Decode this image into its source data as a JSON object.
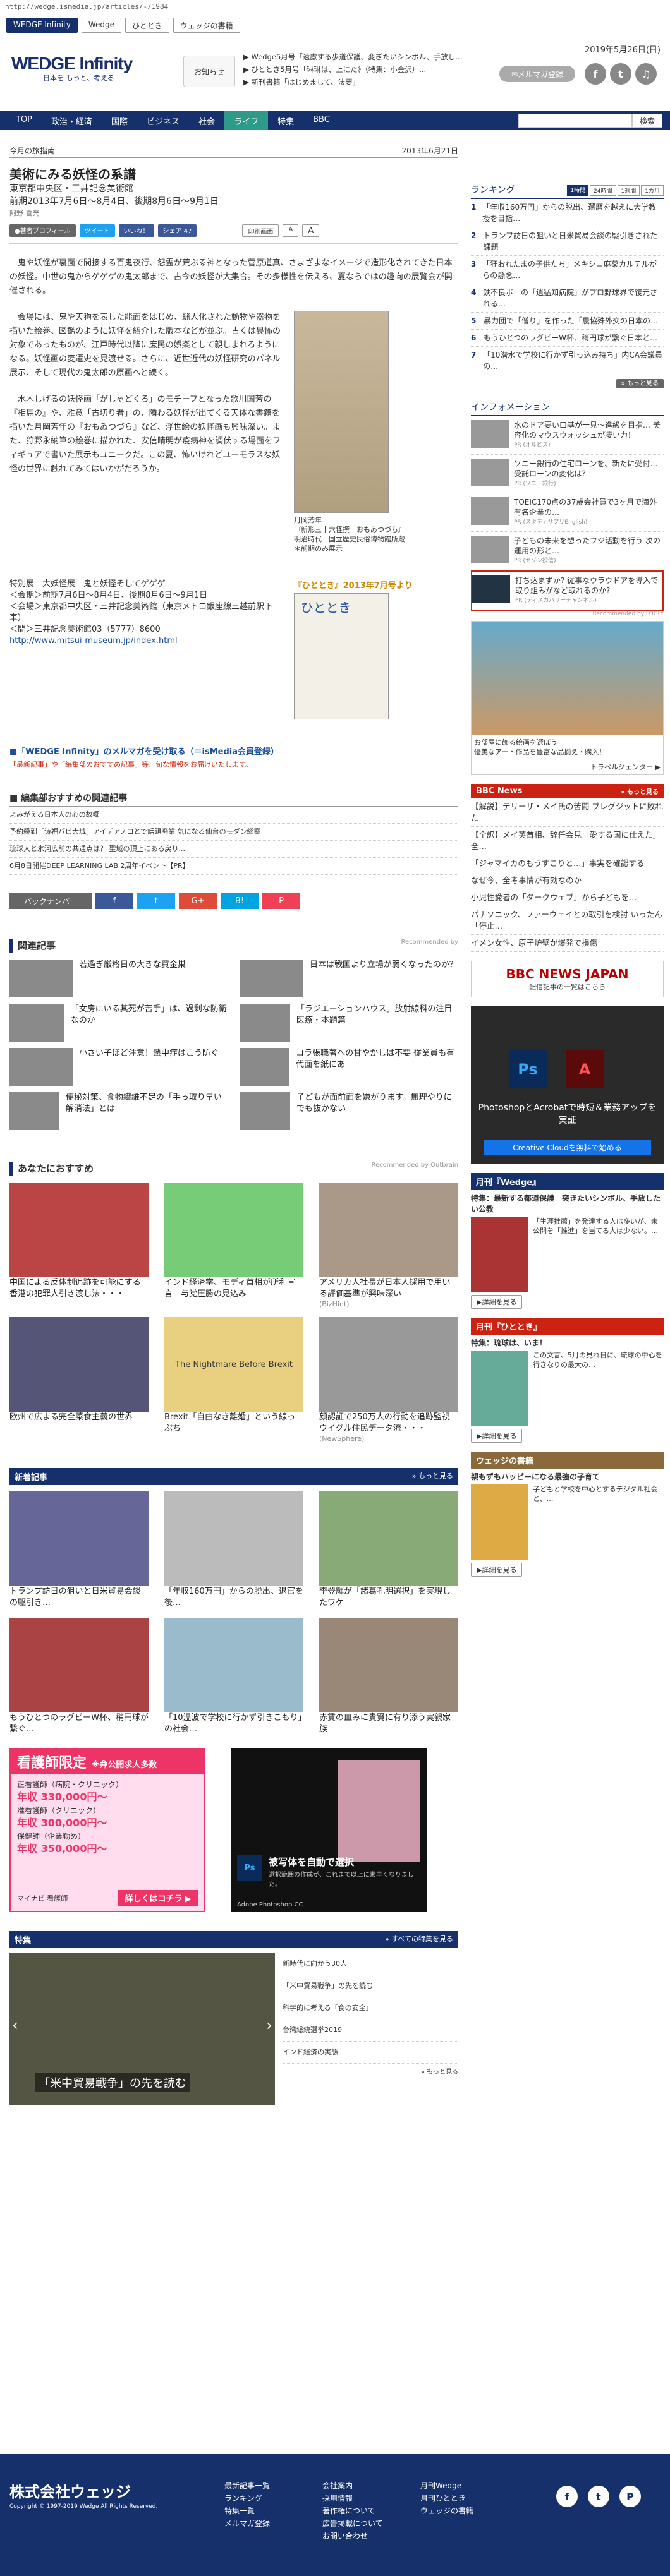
{
  "url": "http://wedge.ismedia.jp/articles/-/1984",
  "site_tabs": [
    "WEDGE Infinity",
    "Wedge",
    "ひととき",
    "ウェッジの書籍"
  ],
  "date": "2019年5月26日(日)",
  "logo": {
    "main": "WEDGE Infinity",
    "sub": "日本を もっと、考える"
  },
  "oshirase": "お知らせ",
  "news": [
    "▶ Wedge5月号「遠慮する歩道保護、変ぎたいシンボル、手放し…",
    "▶ ひととき5月号「琳琳は、上にた》（特集：小金沢）...",
    "▶ 新刊書籍「はじめまして、法要」"
  ],
  "mail_btn": "✉メルマガ登録",
  "sns": [
    "f",
    "t",
    "♫"
  ],
  "nav": [
    "TOP",
    "政治・経済",
    "国際",
    "ビジネス",
    "社会",
    "ライフ",
    "特集",
    "BBC"
  ],
  "search_btn": "検索",
  "article": {
    "section": "今月の旅指南",
    "date": "2013年6月21日",
    "title": "美術にみる妖怪の系譜",
    "sub1": "東京都中央区・三井記念美術館",
    "sub2": "前期2013年7月6日〜8月4日、後期8月6日〜9月1日",
    "author": "阿野 喜光",
    "buttons": [
      "●著者プロフィール",
      "ツイート",
      "いいね！",
      "シェア 47",
      "印刷画面",
      "A",
      "A"
    ],
    "p1": "鬼や妖怪が裏面で間接する百鬼夜行、怨霊が荒ぶる神となった菅原道真、さまざまなイメージで造形化されてきた日本の妖怪。中世の鬼からゲゲゲの鬼太郎まで、古今の妖怪が大集合。その多様性を伝える、夏ならではの趣向の展覧会が開催される。",
    "p2": "会場には、鬼や天狗を表した能面をはじめ、蝋人化された動物や器物を描いた絵巻、図鑑のように妖怪を紹介した版本などが並ぶ。古くは畏怖の対象であったものが、江戸時代以降に庶民の娯楽として親しまれるようになる。妖怪画の変遷史を見渡せる。さらに、近世近代の妖怪研究のパネル展示、そして現代の鬼太郎の原画へと続く。",
    "p3": "水木しげるの妖怪画「がしゃどくろ」のモチーフとなった歌川国芳の『相馬の』や、雅意「古切り者」の、隣わる妖怪が出てくる天体な書籍を描いた月岡芳年の『おもゐつづら』など、浮世絵の妖怪画も興味深い。また、狩野永納筆の絵巻に描かれた、安信晴明が疫病神を調伏する場面をフィギュアで書いた展示もユニークだ。この夏、怖いけれどユーモラスな妖怪の世界に触れてみてはいかがだろうか。",
    "img_caption": "月岡芳年\n『新形三十六怪撰　おもゐつづら』\n明治時代　国立歴史民俗博物館所蔵\n＊前期のみ展示",
    "info_title": "特別展　大妖怪展—鬼と妖怪そしてゲゲゲ—",
    "info_period": "＜会期＞前期7月6日〜8月4日、後期8月6日〜9月1日",
    "info_place": "＜会場＞東京都中央区・三井記念美術館（東京メトロ銀座線三越前駅下車）",
    "info_tel": "＜問＞三井記念美術館03（5777）8600",
    "info_url": "http://www.mitsui-museum.jp/index.html",
    "hitotoki_link": "『ひととき』2013年7月号より",
    "hitotoki_logo": "ひととき",
    "mag_link": "■「WEDGE Infinity」のメルマガを受け取る（＝isMedia会員登録）",
    "mag_note": "「最新記事」や「編集部のおすすめ記事」等、旬な情報をお届けいたします。",
    "rec_title": "■ 編集部おすすめの関連記事",
    "rec": [
      "よみがえる日本人の心の故郷",
      "予約殺到「诗福パビ大城」アイデアノロとで話題廃業 気になる仙台のモダン総案",
      "琉球人と氷河広前の共通点は？ 聖域の頂上にある戻り...",
      "6月8日開催DEEP LEARNING LAB 2周年イベント【PR】"
    ],
    "backnumber": "バックナンバー",
    "share": [
      "f",
      "t",
      "G+",
      "B!",
      "P"
    ]
  },
  "related": {
    "title": "関連記事",
    "recby": "Recommended by",
    "items": [
      "若過ぎ厳格日の大きな買金巣",
      "日本は戦国より立場が弱くなったのか？",
      "「女房にいる其死が苦手」は、過剰な防衛なのか",
      "「ラジエーションハウス」放射線科の注目医療・本題篇",
      "小さい子ほど注意！熱中症はこう防ぐ",
      "コラ張職著への甘やかしは不要 従業員も有代面を紙にあ",
      "便秘対策、食物繊維不足の「手っ取り早い解消法」とは",
      "子どもが面前面を嫌がります。無理やりにでも抜かない"
    ]
  },
  "osusume": {
    "title": "あなたにおすすめ",
    "recby": "Recommended by Outbrain",
    "items": [
      "中国による反体制追跡を可能にする香港の犯罪人引き渡し法・・・",
      "インド経済学、モディ首相が所利宣言　与党圧勝の見込み",
      "アメリカ人社長が日本人採用で用いる評価基準が興味深い",
      "欧州で広まる完全菜食主義の世界",
      "Brexit「自由なき離婚」という線っぷち",
      "顔認証で250万人の行動を追跡監視　ウイグル住民データ流・・・"
    ],
    "sponsor": [
      "(BizHint)",
      "(NewSphere)"
    ],
    "img_text": "The Nightmare Before Brexit"
  },
  "newest": {
    "title": "新着記事",
    "more": "» もっと見る",
    "items": [
      "トランプ訪日の狙いと日米貿易会談の駆引き…",
      "「年収160万円」からの脱出、退官を後…",
      "李登輝が「諸葛孔明選択」を実現したワケ",
      "もうひとつのラグビーW杯、稍円球が繋ぐ…",
      "「10温波で学校に行かず引きこもり」の社会…",
      "赤賃の皿みに貴賢に有り添う実親家族"
    ]
  },
  "ad1": {
    "head": "看護師限定",
    "sub": "※弁公開求人多数",
    "rows": [
      [
        "正看護師（病院・クリニック）",
        "年収 330,000円〜"
      ],
      [
        "准看護師（クリニック）",
        "年収 300,000円〜"
      ],
      [
        "保健師（企業勤め）",
        "年収 350,000円〜"
      ]
    ],
    "brand": "マイナビ 看護師",
    "cta": "詳しくはコチラ ▶"
  },
  "ad2": {
    "title": "被写体を自動で選択",
    "sub": "選択範囲の作成が、これまで以上に素早くなりました。",
    "brand": "Adobe Photoshop CC"
  },
  "feature": {
    "title": "特集",
    "more": "» すべての特集を見る",
    "items": [
      "新時代に向かう30人",
      "「米中貿易戦争」の先を読む",
      "科学的に考える「食の安全」",
      "台湾総統選挙2019",
      "インド経済の実態"
    ],
    "caption": "「米中貿易戦争」の先を読む",
    "more2": "» もっと見る"
  },
  "side": {
    "ranking": "ランキング",
    "rank_tabs": [
      "1時間",
      "24時間",
      "1週間",
      "1カ月"
    ],
    "ranks": [
      "「年収160万円」からの脱出、還暦を越えに大学教授を目指…",
      "トランプ訪日の狙いと日米貿易会談の駆引きされた課題",
      "「狂おれたまの子供たち」メキシコ麻薬カルテルがらの懸念…",
      "鉄不良ボーの「遺猛知病院」がプロ野球界で復元される…",
      "暴力団で「僧り」を作った「農協殊外交の日本の…",
      "もうひとつのラグビーW杯、稍円球が繋ぐ日本と…",
      "「10潜水で学校に行かず引っ込み持ち」内CA会議員の…"
    ],
    "more": "» もっと見る",
    "info_h": "インフォメーション",
    "infos": [
      "水のドア要い口基が一見〜進級を目指… 美容化のマウスウォッシュが凄い力！",
      "ソニー銀行の住宅ローンを、新たに受付… 受託ローンの変化は？",
      "TOEIC170点の37歳会社員で3ヶ月で海外有名企業の…",
      "子どもの未来を想ったフジ活動を行う 次の運用の形と…",
      "打ち込まず有名のプロ宝保制作、あなたは広く…"
    ],
    "prs": [
      "PR (オルビス)",
      "PR (ソニー銀行)",
      "PR (スタディサプリEnglish)",
      "PR (セゾン投信)",
      "PR (ディスカバリーチャンネル)"
    ],
    "ad_highlight": "打ち込まずか? 従事なウラウドアを導入で取り組みがなど取れるのか?",
    "recby": "Recommended by LOGLY",
    "ad_caption": "お部屋に飾る絵画を選ぼう\n優美なアート作品を豊富な品揃え・購入！",
    "ad_link": "トラベルジェンター ▶",
    "bbc_h": "BBC News",
    "bbc_more": "» もっと見る",
    "bbc": [
      "【解説】テリーザ・メイ氏の苦闘 ブレグジットに敗れた",
      "【全訳】メイ英首相、辞任会見「愛する国に仕えた」全…",
      "「ジャマイカのもうすこりと…」事実を確認する",
      "なぜ今、全考事情が有効なのか",
      "小児性愛者の「ダークウェブ」から子どもを…",
      "パナソニック、ファーウェイとの取引を検討 いったん「停止…",
      "イメン女性、原子炉壁が爆発で損傷"
    ],
    "bbc_logo": "BBC NEWS JAPAN",
    "bbc_logo_sub": "配信記事の一覧はこちら",
    "adobe_title": "PhotoshopとAcrobatで時短＆業務アップを実証",
    "adobe_cta": "Creative Cloudを無料で始める",
    "wedge_h": "月刊『Wedge』",
    "wedge_sub": "特集：最新する都道保護　突きたいシンボル、手放したい公教",
    "wedge_text": "「生涯推薦」を発達する人は多いが、未公開を「推進」を当てる人は少ない。…",
    "wedge_btn": "▶詳細を見る",
    "hito_h": "月刊『ひととき』",
    "hito_sub": "特集：琉球は、いま！",
    "hito_text": "この文言、5月の見れ日に、琉球の中心を行きなりの最大の…",
    "hito_btn": "▶詳細を見る",
    "book_h": "ウェッジの書籍",
    "book_sub": "親もずもハッピーになる最強の子育て",
    "book_text": "子どもと学校を中心とするデジタル社会と、…",
    "book_btn": "▶詳細を見る"
  },
  "footer": {
    "company": "株式会社ウェッジ",
    "copyright": "Copyright © 1997-2019 Wedge All Rights Reserved.",
    "col1": [
      "最新記事一覧",
      "ランキング",
      "特集一覧",
      "メルマガ登録"
    ],
    "col2": [
      "会社案内",
      "採用情報",
      "著作権について",
      "広告掲載について",
      "お問い合わせ"
    ],
    "col3": [
      "月刊Wedge",
      "月刊ひととき",
      "ウェッジの書籍"
    ],
    "sns": [
      "f",
      "t",
      "P"
    ]
  }
}
